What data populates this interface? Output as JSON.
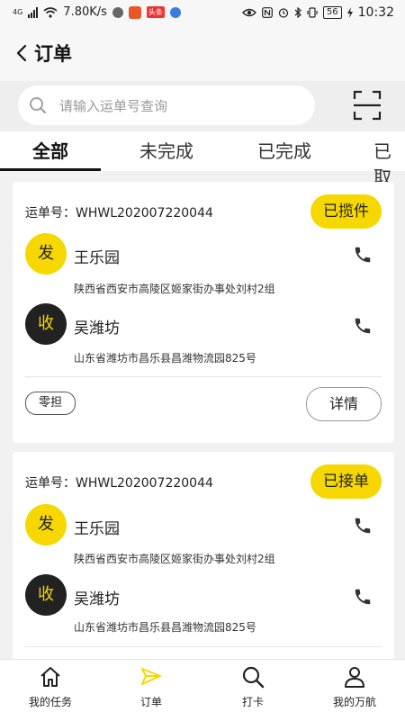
{
  "status_bar": {
    "network": "4G",
    "speed": "7.80K/s",
    "app_badge": "头条",
    "battery": "56",
    "time": "10:32"
  },
  "header": {
    "title": "订单"
  },
  "search": {
    "placeholder": "请输入运单号查询"
  },
  "tabs": [
    {
      "label": "全部"
    },
    {
      "label": "未完成"
    },
    {
      "label": "已完成"
    },
    {
      "label": "已取"
    }
  ],
  "orders": [
    {
      "waybill": "运单号：WHWL202007220044",
      "status": "已揽件",
      "sender": {
        "tag": "发",
        "name": "王乐园",
        "address": "陕西省西安市高陵区姬家街办事处刘村2组"
      },
      "receiver": {
        "tag": "收",
        "name": "吴潍坊",
        "address": "山东省潍坊市昌乐县昌潍物流园825号"
      },
      "badge": "零担",
      "detail": "详情"
    },
    {
      "waybill": "运单号：WHWL202007220044",
      "status": "已接单",
      "sender": {
        "tag": "发",
        "name": "王乐园",
        "address": "陕西省西安市高陵区姬家街办事处刘村2组"
      },
      "receiver": {
        "tag": "收",
        "name": "吴潍坊",
        "address": "山东省潍坊市昌乐县昌潍物流园825号"
      }
    }
  ],
  "nav": [
    {
      "label": "我的任务",
      "icon": "home-icon"
    },
    {
      "label": "订单",
      "icon": "send-icon"
    },
    {
      "label": "打卡",
      "icon": "search-icon"
    },
    {
      "label": "我的万航",
      "icon": "user-icon"
    }
  ],
  "colors": {
    "accent": "#f6d800",
    "dark": "#222222"
  }
}
